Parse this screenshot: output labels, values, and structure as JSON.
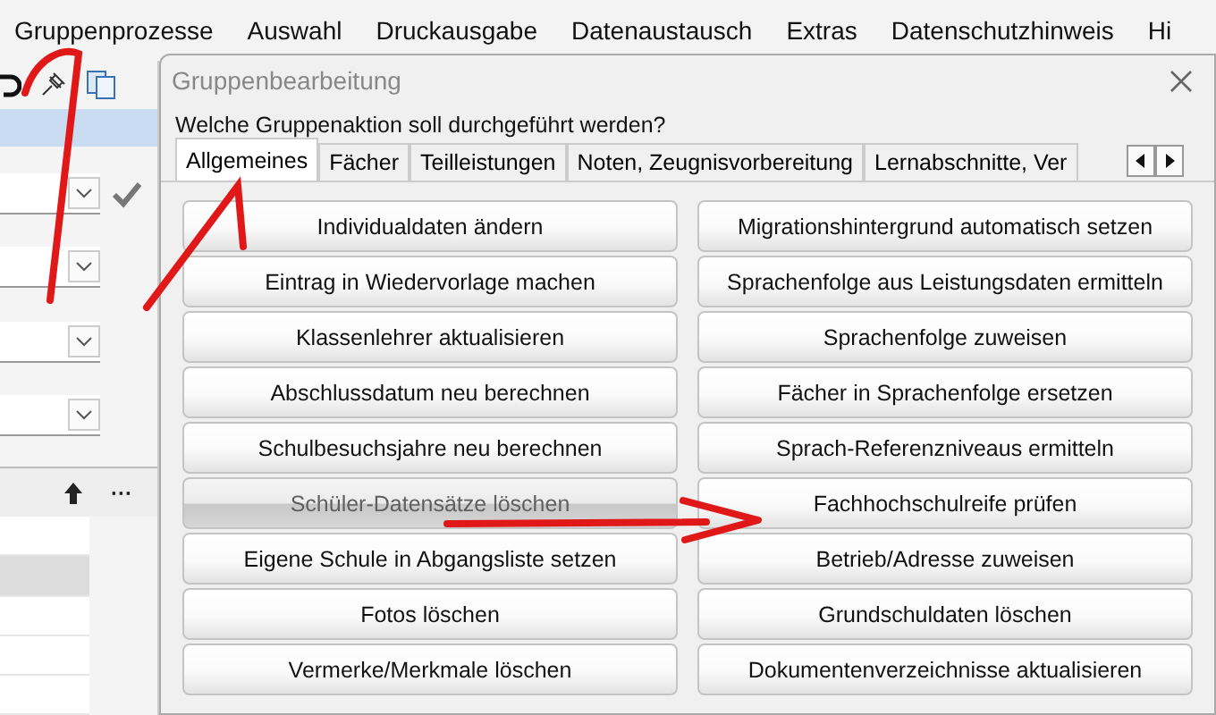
{
  "menu_bar": [
    {
      "label": "Gruppenprozesse"
    },
    {
      "label": "Auswahl"
    },
    {
      "label": "Druckausgabe"
    },
    {
      "label": "Datenaustausch"
    },
    {
      "label": "Extras"
    },
    {
      "label": "Datenschutzhinweis"
    },
    {
      "label": "Hi"
    }
  ],
  "side_panel": {
    "list_toolbar": {
      "more": "···"
    },
    "table_rows": [
      {
        "selected": false
      },
      {
        "selected": true
      },
      {
        "selected": false
      },
      {
        "selected": false
      },
      {
        "selected": false
      }
    ]
  },
  "dialog": {
    "title": "Gruppenbearbeitung",
    "question": "Welche Gruppenaktion soll durchgeführt werden?",
    "tabs": [
      {
        "label": "Allgemeines",
        "selected": true
      },
      {
        "label": "Fächer",
        "selected": false
      },
      {
        "label": "Teilleistungen",
        "selected": false
      },
      {
        "label": "Noten, Zeugnisvorbereitung",
        "selected": false
      },
      {
        "label": "Lernabschnitte, Ver",
        "selected": false
      }
    ],
    "actions": [
      {
        "label": "Individualdaten ändern",
        "disabled": false
      },
      {
        "label": "Migrationshintergrund automatisch setzen",
        "disabled": false
      },
      {
        "label": "Eintrag in Wiedervorlage machen",
        "disabled": false
      },
      {
        "label": "Sprachenfolge aus Leistungsdaten ermitteln",
        "disabled": false
      },
      {
        "label": "Klassenlehrer aktualisieren",
        "disabled": false
      },
      {
        "label": "Sprachenfolge zuweisen",
        "disabled": false
      },
      {
        "label": "Abschlussdatum neu berechnen",
        "disabled": false
      },
      {
        "label": "Fächer in Sprachenfolge ersetzen",
        "disabled": false
      },
      {
        "label": "Schulbesuchsjahre neu berechnen",
        "disabled": false
      },
      {
        "label": "Sprach-Referenzniveaus ermitteln",
        "disabled": false
      },
      {
        "label": "Schüler-Datensätze löschen",
        "disabled": true
      },
      {
        "label": "Fachhochschulreife prüfen",
        "disabled": false
      },
      {
        "label": "Eigene Schule in Abgangsliste setzen",
        "disabled": false
      },
      {
        "label": "Betrieb/Adresse zuweisen",
        "disabled": false
      },
      {
        "label": "Fotos löschen",
        "disabled": false
      },
      {
        "label": "Grundschuldaten löschen",
        "disabled": false
      },
      {
        "label": "Vermerke/Merkmale löschen",
        "disabled": false
      },
      {
        "label": "Dokumentenverzeichnisse aktualisieren",
        "disabled": false
      }
    ]
  }
}
